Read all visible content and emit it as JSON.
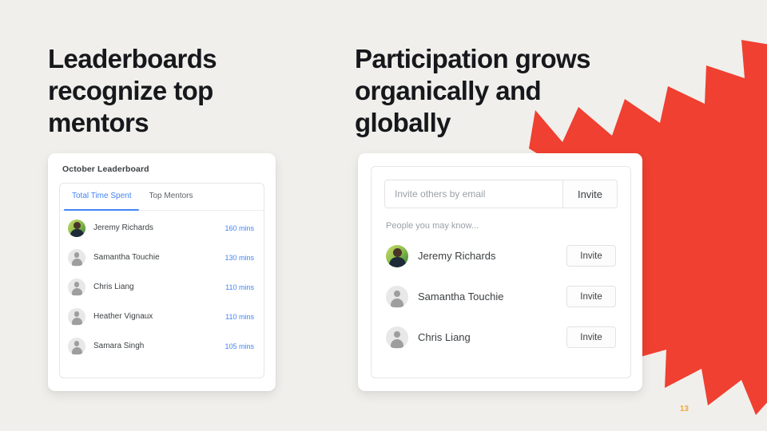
{
  "slide": {
    "background_color": "#F0EFEB",
    "page_number": "13",
    "accent_red": "#EF4031",
    "accent_blue": "#4285F4",
    "page_number_color": "#F2A83C"
  },
  "left": {
    "heading": "Leaderboards recognize top mentors",
    "card": {
      "title": "October Leaderboard",
      "tabs": [
        {
          "label": "Total Time Spent",
          "active": true
        },
        {
          "label": "Top Mentors",
          "active": false
        }
      ],
      "rows": [
        {
          "name": "Jeremy Richards",
          "value": "160 mins",
          "avatar": "photo"
        },
        {
          "name": "Samantha Touchie",
          "value": "130 mins",
          "avatar": "placeholder"
        },
        {
          "name": "Chris Liang",
          "value": "110 mins",
          "avatar": "placeholder"
        },
        {
          "name": "Heather Vignaux",
          "value": "110 mins",
          "avatar": "placeholder"
        },
        {
          "name": "Samara Singh",
          "value": "105 mins",
          "avatar": "placeholder"
        }
      ]
    }
  },
  "right": {
    "heading": "Participation grows organically and globally",
    "card": {
      "invite_placeholder": "Invite others by email",
      "invite_value": "",
      "invite_button": "Invite",
      "people_label": "People you may know...",
      "people": [
        {
          "name": "Jeremy Richards",
          "button": "Invite",
          "avatar": "photo"
        },
        {
          "name": "Samantha Touchie",
          "button": "Invite",
          "avatar": "placeholder"
        },
        {
          "name": "Chris Liang",
          "button": "Invite",
          "avatar": "placeholder"
        }
      ]
    }
  }
}
